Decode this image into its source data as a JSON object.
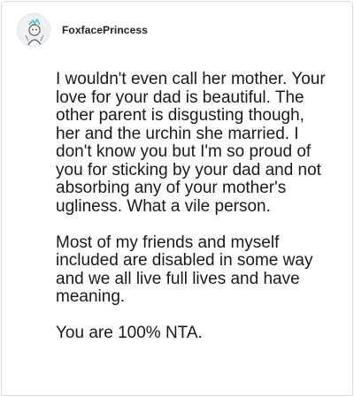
{
  "comment": {
    "username": "FoxfacePrincess",
    "avatar_icon": "user-avatar",
    "paragraphs": [
      "I wouldn't even call her mother. Your love for your dad is beautiful. The other parent is disgusting though, her and the urchin she married. I don't know you but I'm so proud of you for sticking by your dad and not absorbing any of your mother's ugliness. What a vile person.",
      "Most of my friends and myself included are disabled in some way and we all live full lives and have meaning.",
      "You are 100% NTA."
    ]
  },
  "colors": {
    "text": "#1a1a1a",
    "username": "#222222",
    "border": "#d9d9d9",
    "avatar_accent": "#4fc3c9"
  }
}
